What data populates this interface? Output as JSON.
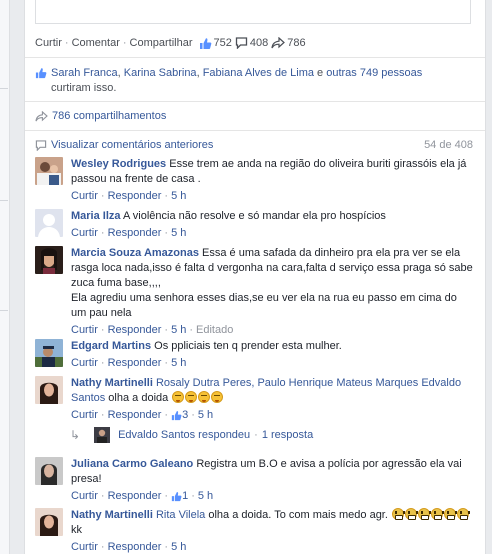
{
  "post_actions": {
    "like": "Curtir",
    "comment": "Comentar",
    "share": "Compartilhar",
    "like_count": "752",
    "comment_count": "408",
    "share_count": "786"
  },
  "likes_summary": {
    "names": [
      "Sarah Franca",
      "Karina Sabrina",
      "Fabiana Alves de Lima"
    ],
    "separators": [
      ", ",
      ", ",
      " e "
    ],
    "others": "outras 749 pessoas",
    "suffix": " curtiram isso."
  },
  "shares": {
    "label": "786 compartilhamentos"
  },
  "previous_comments": {
    "label": "Visualizar comentários anteriores",
    "count": "54 de 408"
  },
  "comment_actions": {
    "like": "Curtir",
    "reply": "Responder",
    "edited": "Editado"
  },
  "comments": [
    {
      "author": "Wesley Rodrigues",
      "text": "Esse trem ae anda na região do oliveira buriti girassóis ela já passou na frente de casa .",
      "time": "5 h"
    },
    {
      "author": "Maria Ilza",
      "text": "A violência não resolve e só mandar ela pro hospícios",
      "time": "5 h"
    },
    {
      "author": "Marcia Souza Amazonas",
      "text": "Essa é uma safada da dinheiro pra ela pra ver se ela rasga loca nada,isso é falta d vergonha na cara,falta d serviço essa praga só sabe zuca fuma base,,,,",
      "text2": "Ela agrediu uma senhora esses dias,se eu ver ela na rua eu passo em cima do um pau nela",
      "time": "5 h"
    },
    {
      "author": "Edgard Martins",
      "text": "Os ppliciais ten q prender esta mulher.",
      "time": "5 h"
    },
    {
      "author": "Nathy Martinelli",
      "tag": "Rosaly Dutra Peres, Paulo Henrique Mateus Marques Edvaldo Santos",
      "text": " olha a doida ",
      "likes": "3",
      "time": "5 h"
    },
    {
      "author": "Juliana Carmo Galeano",
      "text": "Registra um B.O e avisa a polícia por agressão ela vai presa!",
      "likes": "1",
      "time": "5 h"
    },
    {
      "author": "Nathy Martinelli",
      "tag": "Rita Vilela",
      "text": " olha a doida. To com mais medo agr. ",
      "text2": " kk",
      "time": "5 h"
    }
  ],
  "reply_summary": {
    "name": "Edvaldo Santos respondeu",
    "count": "1 resposta"
  },
  "colors": {
    "link": "#365899",
    "meta": "#90949c",
    "background": "#e9ebee",
    "like_blue": "#5890ff"
  },
  "icons": [
    "thumbs-up-icon",
    "speech-bubble-icon",
    "share-arrow-icon",
    "comment-bubble-icon",
    "reply-arrow-icon",
    "laughing-emoji",
    "fearful-emoji"
  ]
}
